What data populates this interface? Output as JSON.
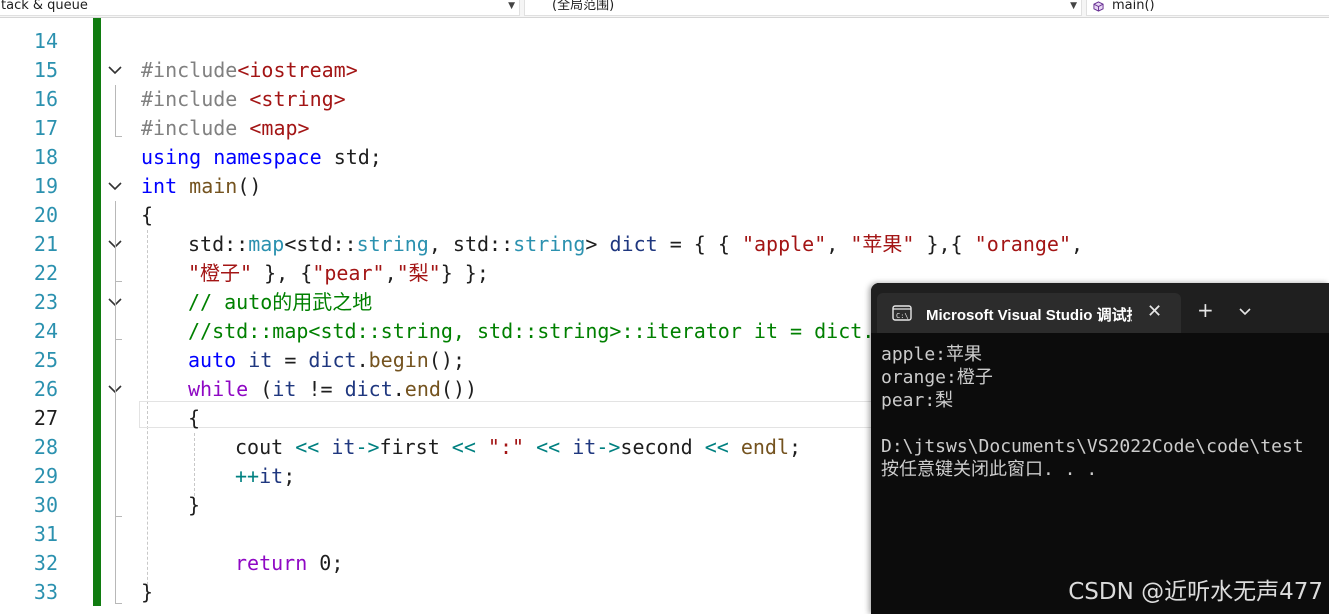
{
  "navbar": {
    "project": "tack & queue",
    "scope": "(全局范围)",
    "member": "main()"
  },
  "editor": {
    "line_numbers": [
      "14",
      "15",
      "16",
      "17",
      "18",
      "19",
      "20",
      "21",
      "22",
      "23",
      "24",
      "25",
      "26",
      "27",
      "28",
      "29",
      "30",
      "31",
      "32",
      "33"
    ],
    "current_line": "27",
    "code": {
      "inc1_kw": "#include",
      "inc1_hdr": "<iostream>",
      "inc2_kw": "#include",
      "inc2_hdr": "<string>",
      "inc3_kw": "#include",
      "inc3_hdr": "<map>",
      "using_kw1": "using",
      "using_kw2": "namespace",
      "using_rest": "std;",
      "int_kw": "int",
      "main_fn": "main",
      "main_parens": "()",
      "brace_open": "{",
      "map_ns1": "std::",
      "map_ty": "map",
      "map_lt": "<std::",
      "string1": "string",
      "map_comma": ", std::",
      "string2": "string",
      "map_gt": "> ",
      "dict_id": "dict",
      "dict_init": " = { { ",
      "s_apple": "\"apple\"",
      "c1": ", ",
      "s_pingguo": "\"苹果\"",
      "c2": " },{ ",
      "s_orange": "\"orange\"",
      "c3": ",",
      "s_chengzi": "\"橙子\"",
      "c4": " }, {",
      "s_pear": "\"pear\"",
      "c5": ",",
      "s_li": "\"梨\"",
      "c6": "} };",
      "comment1": "// auto的用武之地",
      "comment2": "//std::map<std::string, std::string>::iterator it = dict.b",
      "auto_kw": "auto",
      "auto_it": " it",
      "auto_eq": " = ",
      "auto_dict": "dict",
      "auto_dot": ".",
      "auto_begin": "begin",
      "auto_end": "();",
      "while_kw": "while",
      "while_open": " (",
      "while_it": "it",
      "while_ne": " != ",
      "while_dict": "dict",
      "while_dot": ".",
      "while_end_fn": "end",
      "while_close": "())",
      "inner_open": "{",
      "cout_id": "cout",
      "op1": " << ",
      "it1": "it",
      "arrow1": "->",
      "first": "first",
      "op2": " << ",
      "colon_str": "\":\"",
      "op3": " << ",
      "it2": "it",
      "arrow2": "->",
      "second": "second",
      "op4": " << ",
      "endl": "endl",
      "semi": ";",
      "inc_op": "++",
      "inc_it": "it",
      "inc_semi": ";",
      "inner_close": "}",
      "return_kw": "return",
      "return_rest": " 0;",
      "brace_close": "}"
    }
  },
  "console": {
    "tab_title": "Microsoft Visual Studio 调试控制台",
    "close_glyph": "✕",
    "new_tab_glyph": "+",
    "output": [
      "apple:苹果",
      "orange:橙子",
      "pear:梨",
      "",
      "D:\\jtsws\\Documents\\VS2022Code\\code\\test",
      "按任意键关闭此窗口. . ."
    ]
  },
  "watermark": "CSDN @近听水无声477",
  "colors": {
    "change_bar": "#107c10",
    "keyword": "#0000ff",
    "control_keyword": "#8f08c4",
    "type": "#2b91af",
    "string": "#a31515",
    "comment": "#008000",
    "console_bg": "#0c0c0c"
  }
}
